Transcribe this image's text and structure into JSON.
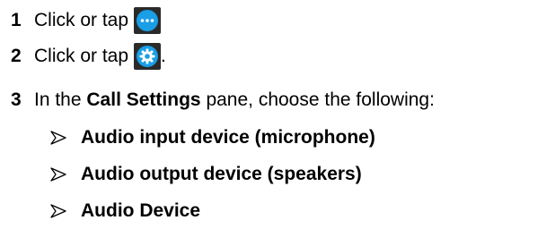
{
  "steps": [
    {
      "number": "1",
      "text_before": "Click or tap",
      "icon": "more-options-icon",
      "text_after": ""
    },
    {
      "number": "2",
      "text_before": "Click or tap",
      "icon": "settings-gear-icon",
      "text_after": "."
    },
    {
      "number": "3",
      "text_before": "In the",
      "bold": "Call Settings",
      "text_after": "pane, choose the following:"
    }
  ],
  "options": [
    "Audio input device (microphone)",
    "Audio output device (speakers)",
    "Audio Device"
  ],
  "colors": {
    "icon_background": "#2a2a2a",
    "icon_accent": "#1a9ee6",
    "text": "#000000"
  }
}
